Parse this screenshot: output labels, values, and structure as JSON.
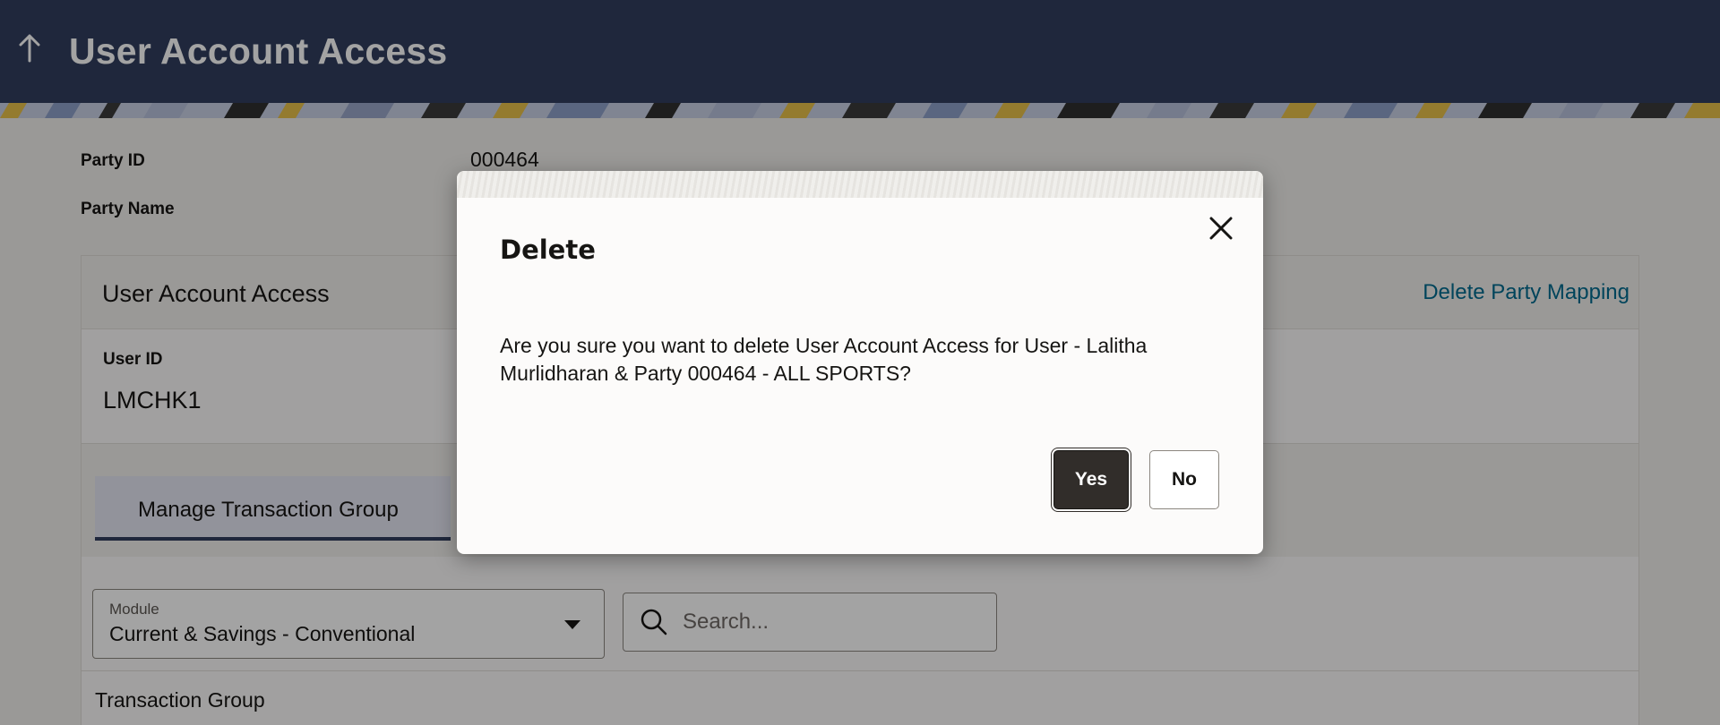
{
  "header": {
    "title": "User Account Access",
    "back_icon": "up-arrow-icon"
  },
  "party": {
    "id_label": "Party ID",
    "id_value": "000464",
    "name_label": "Party Name"
  },
  "panel": {
    "title": "User Account Access",
    "delete_party_mapping": "Delete Party Mapping",
    "user_id_label": "User ID",
    "user_id_value": "LMCHK1",
    "tab_label": "Manage Transaction Group",
    "module_label": "Module",
    "module_value": "Current & Savings - Conventional",
    "search_placeholder": "Search...",
    "transaction_group_label": "Transaction Group"
  },
  "dialog": {
    "title": "Delete",
    "message": "Are you sure you want to delete User Account Access for User - Lalitha Murlidharan & Party 000464 - ALL SPORTS?",
    "yes_label": "Yes",
    "no_label": "No",
    "close_icon": "close-icon"
  },
  "colors": {
    "header_bg": "#313e5e",
    "link": "#006b8f",
    "primary_button": "#312d2a"
  }
}
